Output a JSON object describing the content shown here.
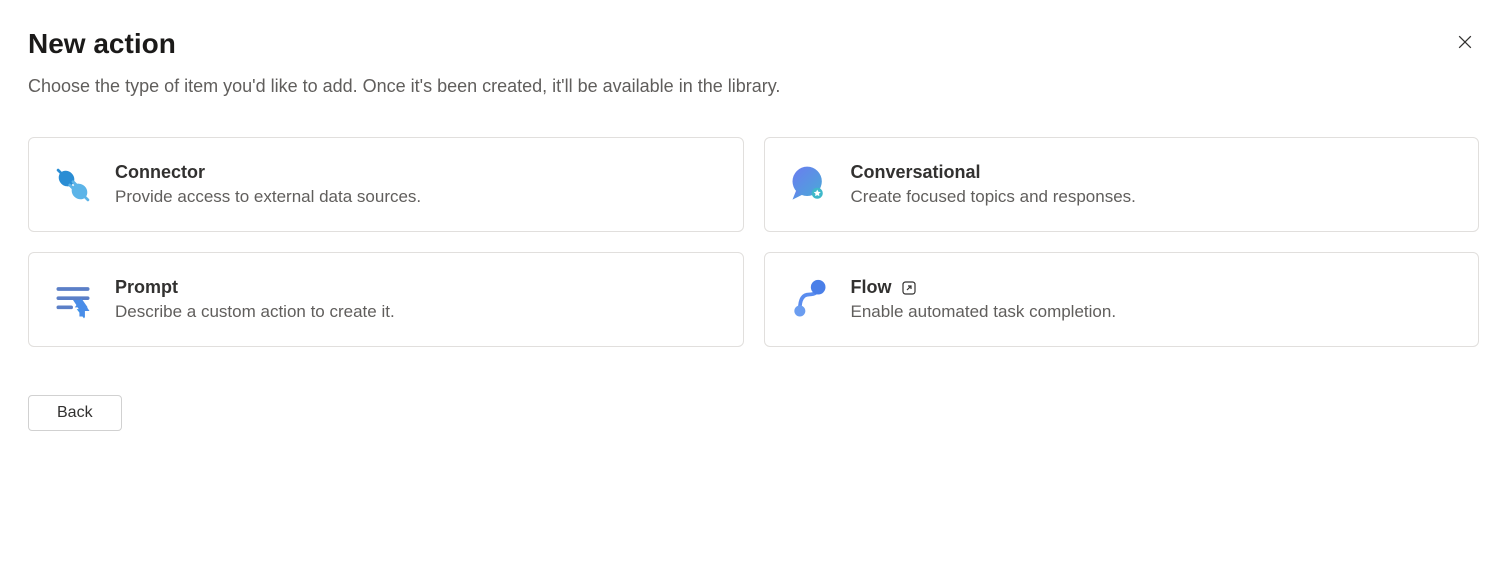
{
  "header": {
    "title": "New action",
    "subtitle": "Choose the type of item you'd like to add. Once it's been created, it'll be available in the library."
  },
  "cards": {
    "connector": {
      "title": "Connector",
      "desc": "Provide access to external data sources."
    },
    "conversational": {
      "title": "Conversational",
      "desc": "Create focused topics and responses."
    },
    "prompt": {
      "title": "Prompt",
      "desc": "Describe a custom action to create it."
    },
    "flow": {
      "title": "Flow",
      "desc": "Enable automated task completion."
    }
  },
  "footer": {
    "back_label": "Back"
  }
}
